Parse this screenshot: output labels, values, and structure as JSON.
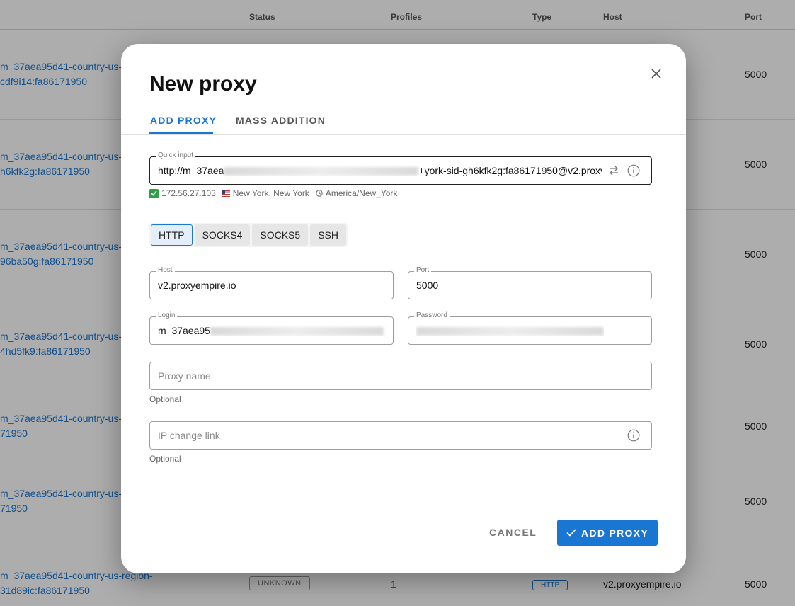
{
  "table": {
    "headers": {
      "status": "Status",
      "profiles": "Profiles",
      "type": "Type",
      "host": "Host",
      "port": "Port"
    },
    "rows": [
      {
        "name_line1": "m_37aea95d41-country-us-",
        "name_line2": "cdf9i14:fa86171950",
        "port": "5000"
      },
      {
        "name_line1": "m_37aea95d41-country-us-",
        "name_line2": "h6kfk2g:fa86171950",
        "port": "5000"
      },
      {
        "name_line1": "m_37aea95d41-country-us-",
        "name_line2": "96ba50g:fa86171950",
        "port": "5000"
      },
      {
        "name_line1": "m_37aea95d41-country-us-",
        "name_line2": "4hd5fk9:fa86171950",
        "port": "5000"
      },
      {
        "name_line1": "m_37aea95d41-country-us-",
        "name_line2": "71950",
        "port": "5000"
      },
      {
        "name_line1": "m_37aea95d41-country-us-",
        "name_line2": "71950",
        "port": "5000"
      },
      {
        "name_line1": "m_37aea95d41-country-us-region-",
        "name_line2": "31d89ic:fa86171950",
        "status": "UNKNOWN",
        "profiles": "1",
        "type": "HTTP",
        "host": "v2.proxyempire.io",
        "port": "5000"
      }
    ]
  },
  "dialog": {
    "title": "New proxy",
    "tabs": {
      "add_proxy": "ADD PROXY",
      "mass_addition": "MASS ADDITION"
    },
    "quick_input": {
      "label": "Quick input",
      "value_start": "http://m_37aea",
      "value_end": "+york-sid-gh6kfk2g:fa86171950@v2.proxy"
    },
    "check": {
      "ip": "172.56.27.103",
      "location": "New York, New York",
      "timezone": "America/New_York"
    },
    "protocols": [
      "HTTP",
      "SOCKS4",
      "SOCKS5",
      "SSH"
    ],
    "selected_protocol": "HTTP",
    "host": {
      "label": "Host",
      "value": "v2.proxyempire.io"
    },
    "port": {
      "label": "Port",
      "value": "5000"
    },
    "login": {
      "label": "Login",
      "value_start": "m_37aea95"
    },
    "password": {
      "label": "Password"
    },
    "proxy_name": {
      "placeholder": "Proxy name",
      "helper": "Optional"
    },
    "ip_change_link": {
      "placeholder": "IP change link",
      "helper": "Optional"
    },
    "cancel_label": "CANCEL",
    "add_label": "ADD PROXY"
  },
  "colors": {
    "accent": "#1976d2",
    "check_green": "#2e9d44"
  },
  "icons": [
    "close-icon",
    "swap-icon",
    "info-icon",
    "check-icon",
    "us-flag-icon",
    "clock-icon"
  ]
}
